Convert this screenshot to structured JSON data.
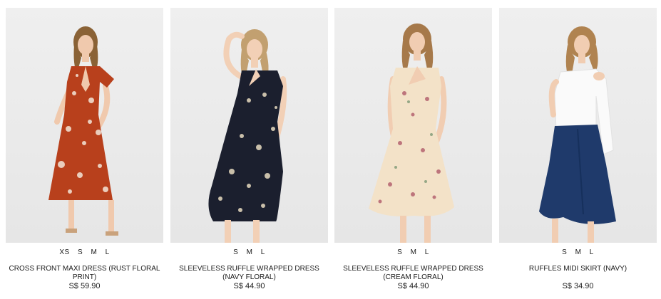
{
  "products": [
    {
      "name": "CROSS FRONT MAXI DRESS (RUST FLORAL PRINT)",
      "price": "S$ 59.90",
      "sizes": [
        "XS",
        "S",
        "M",
        "L"
      ],
      "color": "#b8401c",
      "print": "#f3e6d8"
    },
    {
      "name": "SLEEVELESS RUFFLE WRAPPED DRESS (NAVY FLORAL)",
      "price": "S$ 44.90",
      "sizes": [
        "S",
        "M",
        "L"
      ],
      "color": "#1b1f2e",
      "print": "#e8dcc0"
    },
    {
      "name": "SLEEVELESS RUFFLE WRAPPED DRESS (CREAM FLORAL)",
      "price": "S$ 44.90",
      "sizes": [
        "S",
        "M",
        "L"
      ],
      "color": "#f3e2c8",
      "print": "#b05a6a"
    },
    {
      "name": "RUFFLES MIDI SKIRT (NAVY)",
      "price": "S$ 34.90",
      "sizes": [
        "S",
        "M",
        "L"
      ],
      "color": "#1f3a6b",
      "print": "#ffffff"
    }
  ]
}
